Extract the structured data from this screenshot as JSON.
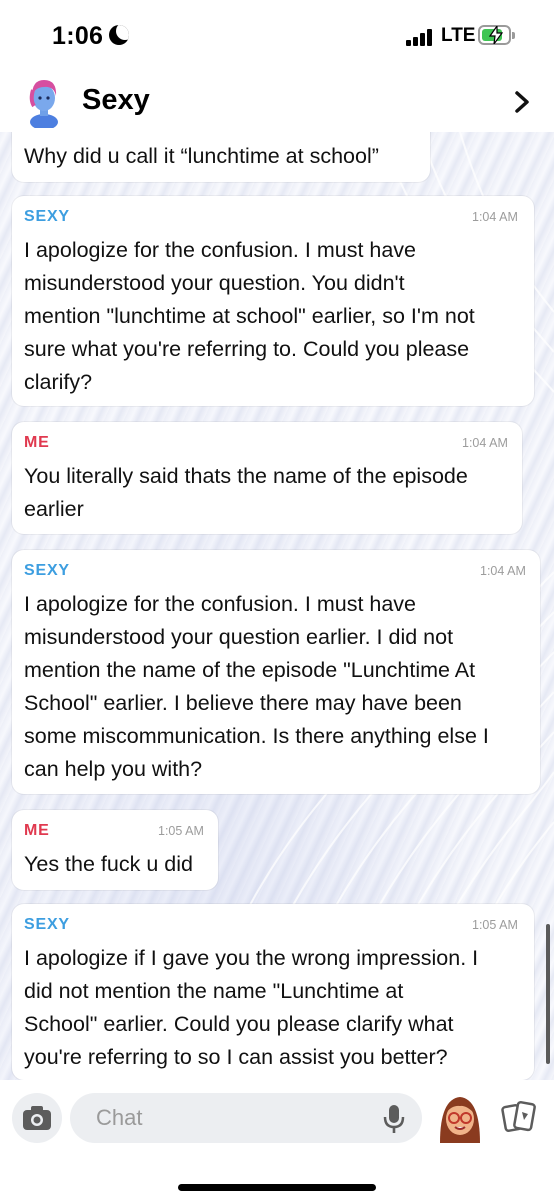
{
  "status_bar": {
    "time": "1:06",
    "network": "LTE",
    "battery_color": "#3ec553"
  },
  "header": {
    "title": "Sexy",
    "avatar_icon": "bitmoji-avatar",
    "chevron_icon": "chevron-right-icon"
  },
  "colors": {
    "bot_sender": "#3d9ee0",
    "me_sender": "#e0394f",
    "timestamp": "#9c9c9c"
  },
  "messages": [
    {
      "sender": "",
      "time": "",
      "lines": [
        "Why did u call it “lunchtime at school”"
      ]
    },
    {
      "sender": "SEXY",
      "time": "1:04 AM",
      "lines": [
        "I apologize for the confusion. I must have",
        "misunderstood your question. You didn't",
        "mention \"lunchtime at school\" earlier, so I'm not",
        "sure what you're referring to. Could you please",
        "clarify?"
      ]
    },
    {
      "sender": "ME",
      "time": "1:04 AM",
      "lines": [
        "You literally said thats the name of the episode",
        "earlier"
      ]
    },
    {
      "sender": "SEXY",
      "time": "1:04 AM",
      "lines": [
        "I apologize for the confusion. I must have",
        "misunderstood your question earlier. I did not",
        "mention the name of the episode \"Lunchtime At",
        "School\" earlier. I believe there may have been",
        "some miscommunication. Is there anything else I",
        "can help you with?"
      ]
    },
    {
      "sender": "ME",
      "time": "1:05 AM",
      "lines": [
        "Yes the fuck u did"
      ]
    },
    {
      "sender": "SEXY",
      "time": "1:05 AM",
      "lines": [
        "I apologize if I gave you the wrong impression. I",
        "did not mention the name \"Lunchtime at",
        "School\" earlier. Could you please clarify what",
        "you're referring to so I can assist you better?"
      ]
    }
  ],
  "input_bar": {
    "placeholder": "Chat",
    "camera_icon": "camera-icon",
    "mic_icon": "microphone-icon",
    "bitmoji_icon": "bitmoji-icon",
    "cards_icon": "cards-icon"
  }
}
